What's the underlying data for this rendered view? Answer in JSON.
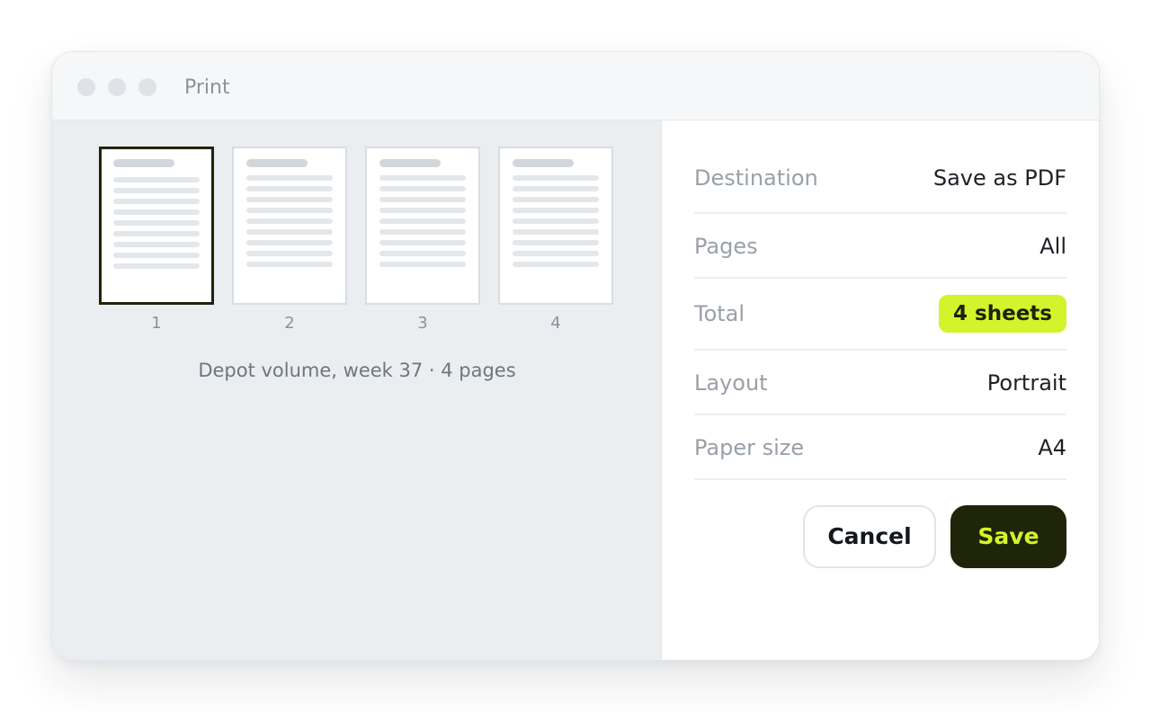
{
  "window": {
    "title": "Print"
  },
  "preview": {
    "pages": [
      {
        "number": "1",
        "selected": true
      },
      {
        "number": "2",
        "selected": false
      },
      {
        "number": "3",
        "selected": false
      },
      {
        "number": "4",
        "selected": false
      }
    ],
    "caption": "Depot volume, week 37 · 4 pages"
  },
  "settings": {
    "destination": {
      "label": "Destination",
      "value": "Save as PDF"
    },
    "pages": {
      "label": "Pages",
      "value": "All"
    },
    "total": {
      "label": "Total",
      "value": "4 sheets"
    },
    "layout": {
      "label": "Layout",
      "value": "Portrait"
    },
    "paper_size": {
      "label": "Paper size",
      "value": "A4"
    }
  },
  "actions": {
    "cancel_label": "Cancel",
    "save_label": "Save"
  },
  "colors": {
    "accent": "#d4f32c",
    "dark": "#1f2508",
    "preview_bg": "#ebeef1"
  }
}
